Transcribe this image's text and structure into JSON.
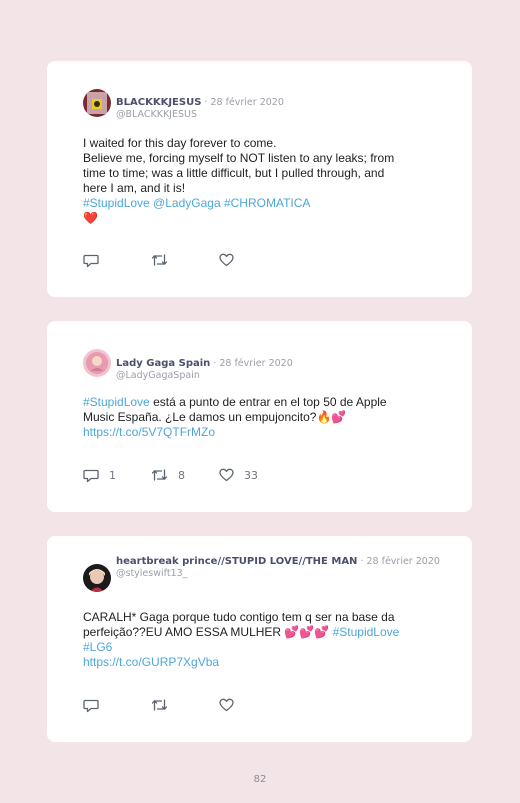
{
  "tweets": [
    {
      "name": "BLACKKKJESUS",
      "date": " · 28 février 2020",
      "handle": "@BLACKKKJESUS",
      "line1": "I waited for this day forever to come.",
      "line2": "Believe me, forcing myself to NOT listen to any leaks; from",
      "line3": "time to time; was a little difficult, but I pulled through, and",
      "line4": "here I am, and it is!",
      "hashtags": "#StupidLove @LadyGaga #CHROMATICA",
      "emoji": "❤️",
      "replies": "",
      "retweets": "",
      "likes": ""
    },
    {
      "name": "Lady Gaga Spain",
      "date": " · 28 février 2020",
      "handle": "@LadyGagaSpain",
      "hashtag": "#StupidLove",
      "text1": " está a punto de entrar en el top 50 de Apple",
      "line2": "Music España. ¿Le damos un empujoncito?🔥💕",
      "url": "https://t.co/5V7QTFrMZo",
      "replies": "1",
      "retweets": "8",
      "likes": "33"
    },
    {
      "name": "heartbreak prince//STUPID LOVE//THE MAN",
      "date": " · 28 février 2020",
      "handle": "@styleswift13_",
      "line1": "CARALH* Gaga porque tudo contigo tem q ser na base da",
      "line2a": "perfeição??EU AMO ESSA MULHER 💕💕💕 ",
      "hashtag1": "#StupidLove",
      "hashtag2": "#LG6",
      "url": "https://t.co/GURP7XgVba",
      "replies": "",
      "retweets": "",
      "likes": ""
    }
  ],
  "icons": [
    "reply-icon",
    "retweet-icon",
    "like-icon"
  ],
  "colors": {
    "background": "#f3e4e8",
    "link": "#4ea6d9",
    "name": "#4b4f6b",
    "meta": "#9a9ea8"
  },
  "page_number": "82"
}
